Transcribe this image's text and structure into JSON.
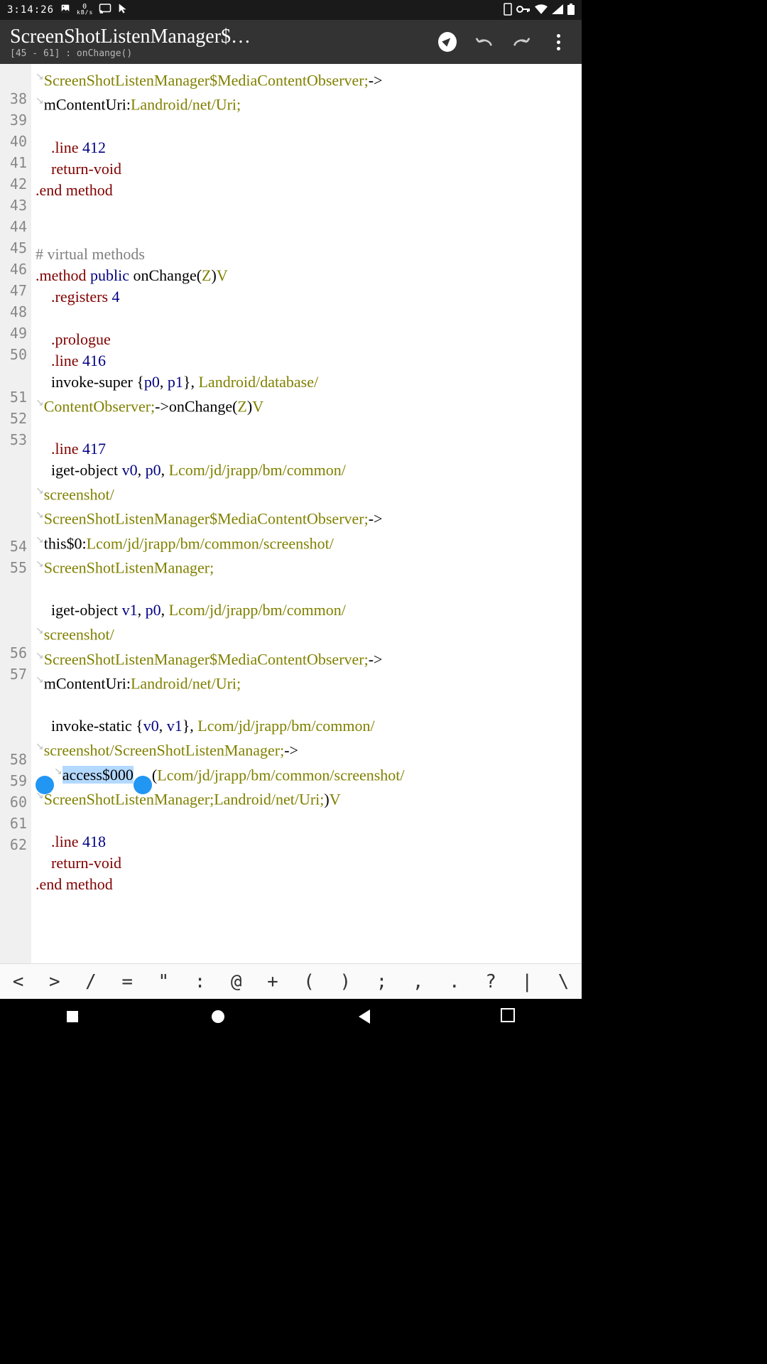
{
  "status": {
    "time": "3:14:26",
    "speed": "0",
    "speed_unit": "kB/s"
  },
  "header": {
    "title": "ScreenShotListenManager$…",
    "subtitle": "[45 - 61] : onChange()"
  },
  "toolbar_keys": [
    "<",
    ">",
    "/",
    "=",
    "\"",
    ":",
    "@",
    "+",
    "(",
    ")",
    ";",
    ",",
    ".",
    "?",
    "|",
    "\\"
  ],
  "gutter": [
    "",
    "38",
    "39",
    "40",
    "41",
    "42",
    "43",
    "44",
    "45",
    "46",
    "47",
    "48",
    "49",
    "50",
    "",
    "51",
    "52",
    "53",
    "",
    "",
    "",
    "",
    "54",
    "55",
    "",
    "",
    "",
    "56",
    "57",
    "",
    "",
    "",
    "58",
    "59",
    "60",
    "61",
    "62"
  ],
  "t": {
    "l1a": "ScreenShotListenManager$MediaContentObserver;",
    "l1b": "->",
    "l2a": "mContentUri:",
    "l2b": "Landroid/net/Uri;",
    "l39a": ".line ",
    "l39b": "412",
    "l40": "return-void",
    "l41": ".end method",
    "l44": "# virtual methods",
    "l45a": ".method ",
    "l45b": "public ",
    "l45c": "onChange(",
    "l45d": "Z",
    "l45e": ")",
    "l45f": "V",
    "l46a": ".registers ",
    "l46b": "4",
    "l48": ".prologue",
    "l49a": ".line ",
    "l49b": "416",
    "l50a": "invoke-super {",
    "l50b": "p0",
    "l50c": ", ",
    "l50d": "p1",
    "l50e": "}, ",
    "l50f": "Landroid/database/",
    "l50g": "ContentObserver;",
    "l50h": "->onChange(",
    "l50i": "Z",
    "l50j": ")",
    "l50k": "V",
    "l52a": ".line ",
    "l52b": "417",
    "l53a": "iget-object ",
    "l53b": "v0",
    "l53c": ", ",
    "l53d": "p0",
    "l53e": ", ",
    "l53f": "Lcom/jd/jrapp/bm/common/",
    "l53g": "screenshot/",
    "l53h": "ScreenShotListenManager$MediaContentObserver;",
    "l53i": "->",
    "l53j": "this$0:",
    "l53k": "Lcom/jd/jrapp/bm/common/screenshot/",
    "l53l": "ScreenShotListenManager;",
    "l55a": "iget-object ",
    "l55b": "v1",
    "l55c": ", ",
    "l55d": "p0",
    "l55e": ", ",
    "l55f": "Lcom/jd/jrapp/bm/common/",
    "l55g": "screenshot/",
    "l55h": "ScreenShotListenManager$MediaContentObserver;",
    "l55i": "->",
    "l55j": "mContentUri:",
    "l55k": "Landroid/net/Uri;",
    "l57a": "invoke-static {",
    "l57b": "v0",
    "l57c": ", ",
    "l57d": "v1",
    "l57e": "}, ",
    "l57f": "Lcom/jd/jrapp/bm/common/",
    "l57g": "screenshot/ScreenShotListenManager;",
    "l57h": "->",
    "l57sel": "access$000",
    "l57i": "(",
    "l57j": "Lcom/jd/jrapp/bm/common/screenshot/",
    "l57k": "ScreenShotListenManager;Landroid/net/Uri;",
    "l57l": ")",
    "l57m": "V",
    "l59a": ".line ",
    "l59b": "418",
    "l60": "return-void",
    "l61": ".end method",
    "wrap": "↘"
  }
}
